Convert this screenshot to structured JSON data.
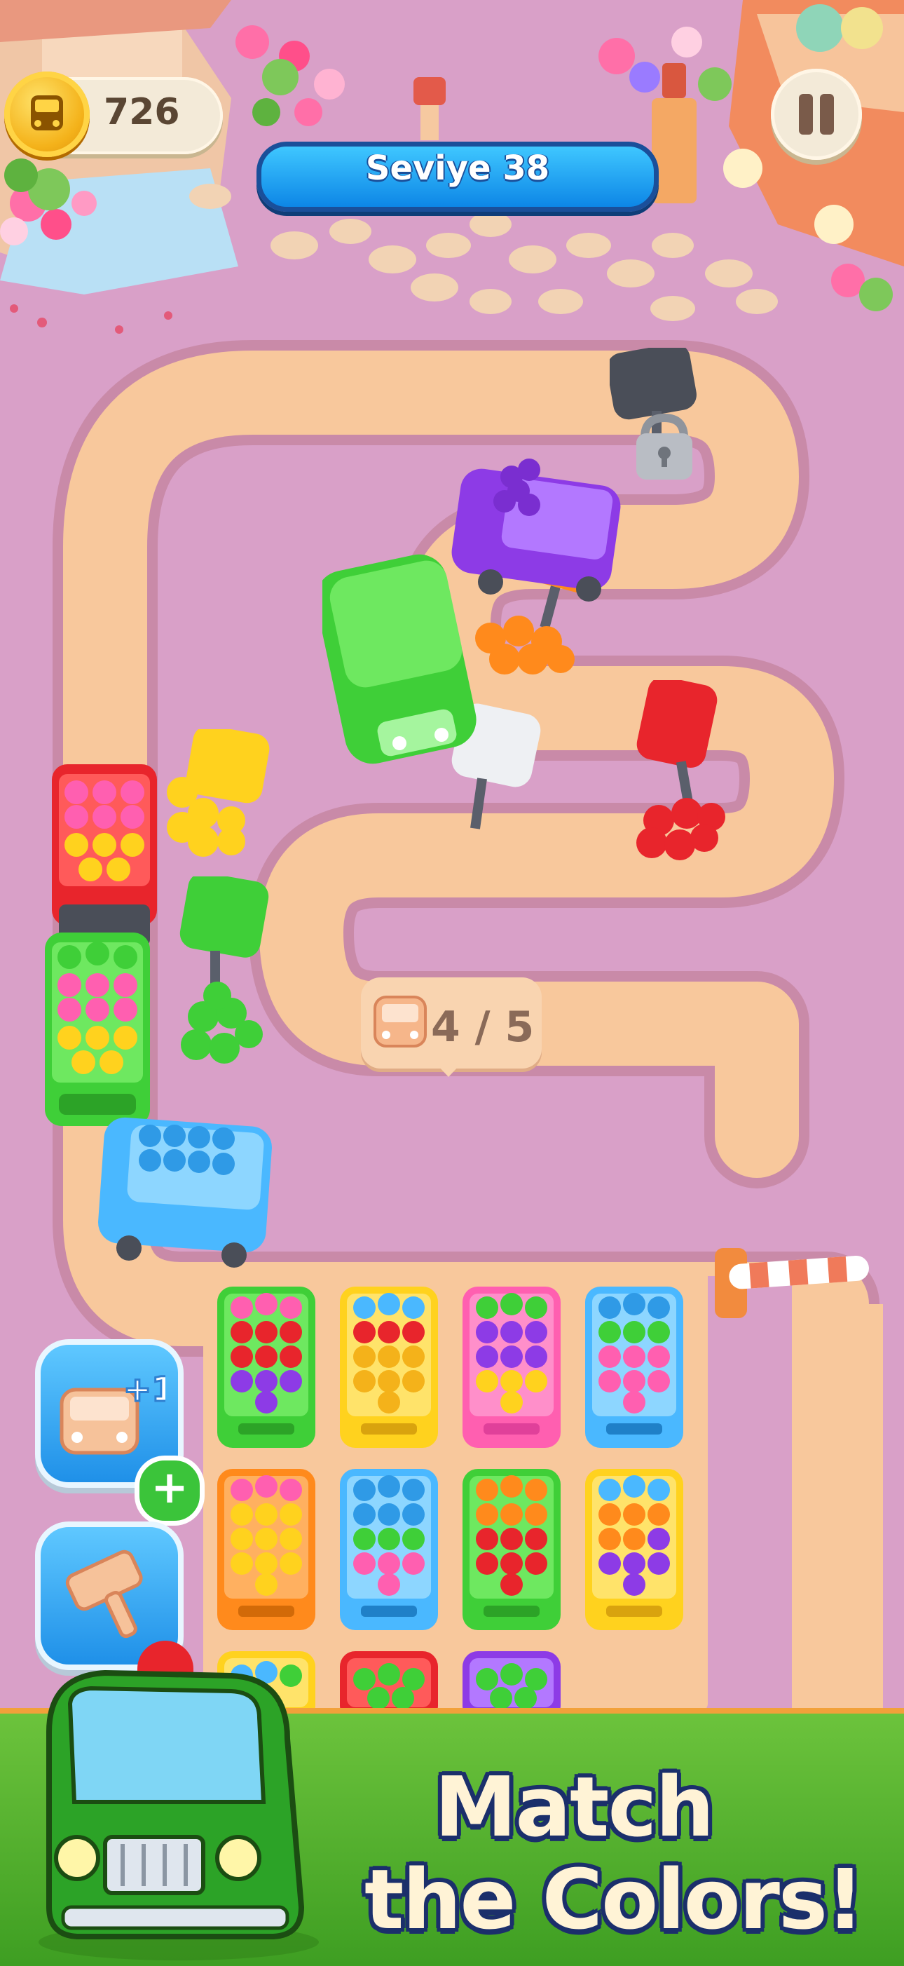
{
  "hud": {
    "coins": "726",
    "level_label": "Seviye 38",
    "pause_icon": "pause-icon",
    "coin_icon": "bus-coin-icon"
  },
  "queue": {
    "counter_text": "4 / 5",
    "counter_icon": "bus-icon"
  },
  "power_ups": [
    {
      "name": "extra-bus",
      "icon": "bus-plus-one-icon",
      "badge": "+1",
      "add_icon": "plus-icon"
    },
    {
      "name": "hammer",
      "icon": "hammer-icon"
    }
  ],
  "banner": {
    "line1": "Match",
    "line2": "the Colors!"
  },
  "colors": {
    "road": "#f8c89c",
    "ground": "#d9a0c8",
    "banner_green": "#4cae2a",
    "title_outline": "#1b2f6b",
    "red": "#e8252c",
    "yellow": "#ffd21e",
    "green": "#3fcf38",
    "blue": "#4ab8ff",
    "purple": "#8d3be6",
    "pink": "#ff5fb0",
    "orange": "#ff8a1c",
    "white": "#eef0f3",
    "gray": "#4a4e58"
  },
  "stops": [
    {
      "color": "gray",
      "state": "locked",
      "icon": "lock-icon"
    },
    {
      "color": "orange",
      "passengers": 6
    },
    {
      "color": "white",
      "passengers": 0
    },
    {
      "color": "red",
      "passengers": 6
    },
    {
      "color": "yellow",
      "passengers": 6
    },
    {
      "color": "green",
      "passengers": 6
    }
  ],
  "parked_vehicles": [
    {
      "color": "green",
      "type": "bus"
    },
    {
      "color": "purple",
      "type": "truck",
      "load": [
        "purple"
      ]
    },
    {
      "color": "red",
      "type": "truck",
      "load": [
        "pink",
        "yellow"
      ]
    },
    {
      "color": "green",
      "type": "truck",
      "load": [
        "green",
        "pink",
        "yellow"
      ]
    },
    {
      "color": "blue",
      "type": "truck",
      "load": [
        "blue"
      ]
    }
  ],
  "grid_vehicles": [
    {
      "color": "green",
      "load": [
        "pink",
        "red",
        "purple"
      ]
    },
    {
      "color": "yellow",
      "load": [
        "blue",
        "red",
        "yellow"
      ]
    },
    {
      "color": "pink",
      "load": [
        "green",
        "purple",
        "yellow"
      ]
    },
    {
      "color": "blue",
      "load": [
        "blue",
        "green",
        "pink"
      ]
    },
    {
      "color": "orange",
      "load": [
        "pink",
        "yellow",
        "yellow"
      ]
    },
    {
      "color": "blue",
      "load": [
        "blue",
        "green",
        "pink"
      ]
    },
    {
      "color": "green",
      "load": [
        "orange",
        "orange",
        "red"
      ]
    },
    {
      "color": "yellow",
      "load": [
        "blue",
        "orange",
        "purple"
      ]
    },
    {
      "color": "yellow",
      "load": [
        "blue"
      ]
    },
    {
      "color": "red",
      "load": [
        "green"
      ]
    },
    {
      "color": "purple",
      "load": [
        "green"
      ]
    }
  ]
}
